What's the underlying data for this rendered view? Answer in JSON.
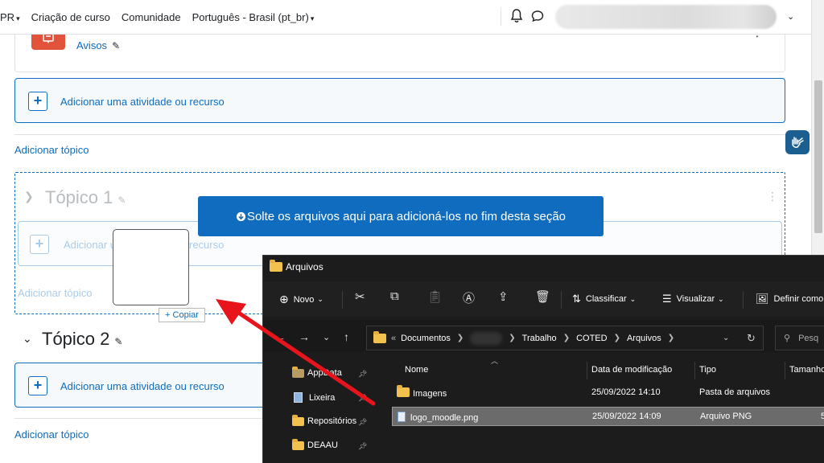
{
  "topbar": {
    "lang_prefix": "PR",
    "course_creation": "Criação de curso",
    "community": "Comunidade",
    "language": "Português - Brasil (pt_br)"
  },
  "course": {
    "announcements_label": "Avisos",
    "add_activity_label": "Adicionar uma atividade ou recurso",
    "add_topic_label": "Adicionar tópico",
    "topic1_title": "Tópico 1",
    "topic2_title": "Tópico 2",
    "drop_message": "Solte os arquivos aqui para adicioná-los no fim desta seção",
    "faded_add_activity_part1": "Adicionar u",
    "faded_add_activity_part2": "recurso",
    "faded_add_topic": "Adicionar tópico",
    "copy_badge": "+ Copiar"
  },
  "explorer": {
    "title": "Arquivos",
    "toolbar": {
      "new": "Novo",
      "sort": "Classificar",
      "view": "Visualizar",
      "set_as": "Definir como"
    },
    "breadcrumb": {
      "prefix": "«",
      "documents": "Documentos",
      "work": "Trabalho",
      "coted": "COTED",
      "files": "Arquivos"
    },
    "search_placeholder": "Pesq",
    "sidebar": [
      {
        "label": "AppData"
      },
      {
        "label": "Lixeira"
      },
      {
        "label": "Repositórios"
      },
      {
        "label": "DEAAU"
      }
    ],
    "columns": {
      "name": "Nome",
      "modified": "Data de modificação",
      "type": "Tipo",
      "size": "Tamanho"
    },
    "rows": [
      {
        "name": "Imagens",
        "modified": "25/09/2022 14:10",
        "type": "Pasta de arquivos",
        "size": ""
      },
      {
        "name": "logo_moodle.png",
        "modified": "25/09/2022 14:09",
        "type": "Arquivo PNG",
        "size": "5"
      }
    ]
  },
  "colors": {
    "moodle_blue": "#0f6cbf",
    "announcement_red": "#e2533c",
    "arrow_red": "#e8141c",
    "explorer_bg": "#1c1c1c"
  }
}
